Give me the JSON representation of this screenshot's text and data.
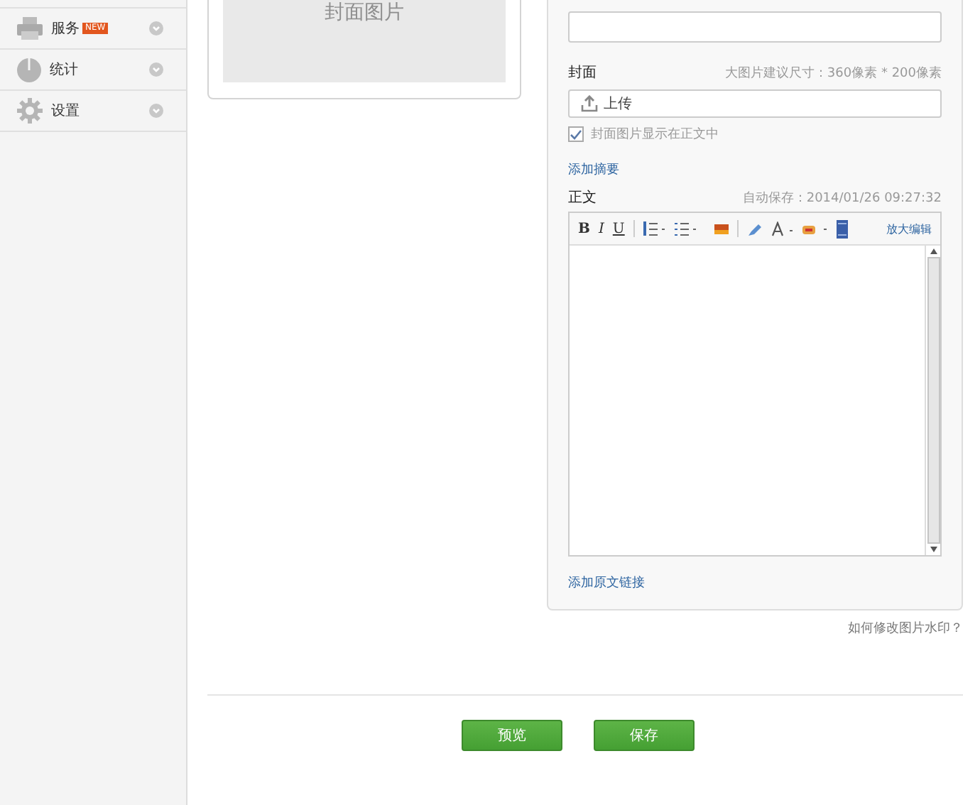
{
  "sidebar": {
    "items": [
      {
        "label": "服务",
        "kind": "printer",
        "badge": "NEW"
      },
      {
        "label": "统计",
        "kind": "pie"
      },
      {
        "label": "设置",
        "kind": "gear"
      }
    ]
  },
  "cover_preview": {
    "placeholder": "封面图片"
  },
  "form": {
    "cover": {
      "label": "封面",
      "hint": "大图片建议尺寸：360像素 * 200像素",
      "upload": "上传",
      "show_in_body": {
        "label": "封面图片显示在正文中",
        "checked": true
      }
    },
    "add_summary": "添加摘要",
    "body": {
      "label": "正文",
      "autosave": "自动保存：2014/01/26 09:27:32",
      "format_buttons": [
        "B",
        "I",
        "U"
      ],
      "expand": "放大编辑"
    },
    "add_source_link": "添加原文链接"
  },
  "watermark_link": "如何修改图片水印？",
  "buttons": [
    "预览",
    "保存"
  ]
}
